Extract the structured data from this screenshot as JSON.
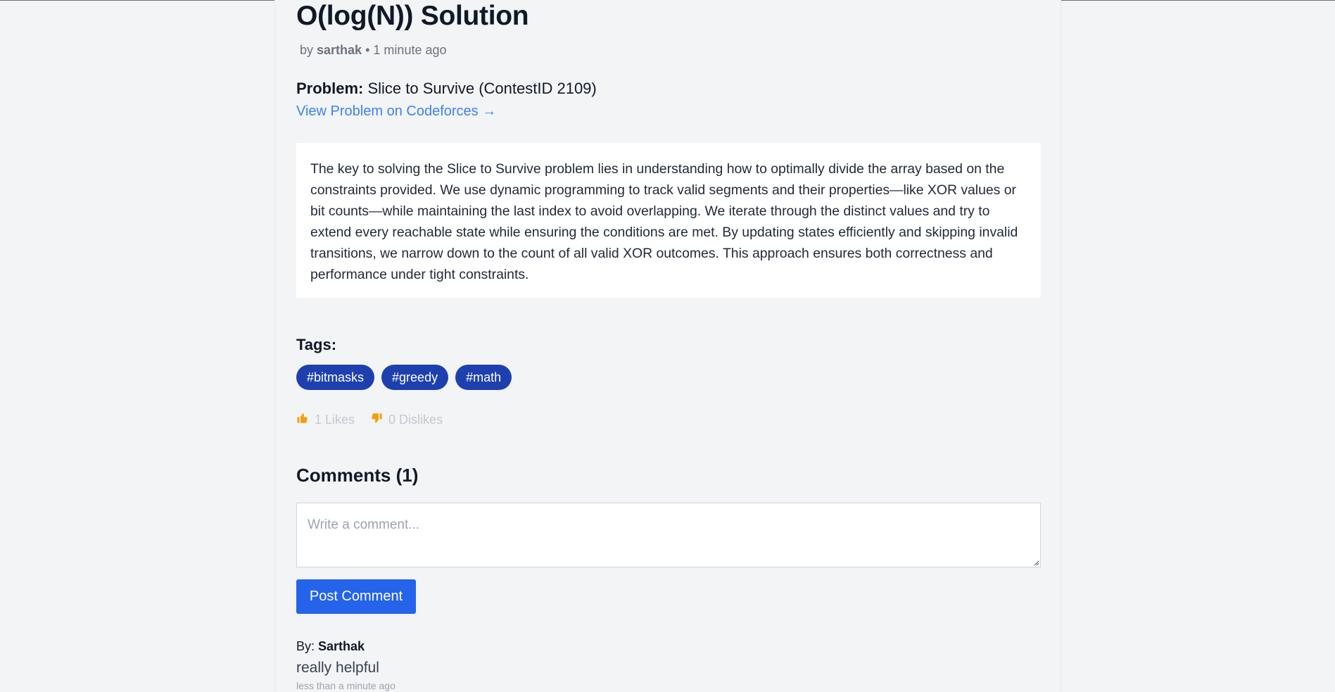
{
  "post": {
    "title": "O(log(N)) Solution",
    "by_prefix": "by",
    "author": "sarthak",
    "separator": "•",
    "time_ago": "1 minute ago",
    "problem_label": "Problem:",
    "problem_name": "Slice to Survive (ContestID 2109)",
    "problem_link": "View Problem on Codeforces →",
    "description": "The key to solving the Slice to Survive problem lies in understanding how to optimally divide the array based on the constraints provided. We use dynamic programming to track valid segments and their properties—like XOR values or bit counts—while maintaining the last index to avoid overlapping. We iterate through the distinct values and try to extend every reachable state while ensuring the conditions are met. By updating states efficiently and skipping invalid transitions, we narrow down to the count of all valid XOR outcomes. This approach ensures both correctness and performance under tight constraints."
  },
  "tags": {
    "heading": "Tags:",
    "items": [
      "#bitmasks",
      "#greedy",
      "#math"
    ]
  },
  "reactions": {
    "likes_icon": "thumbs-up-icon",
    "likes": "1 Likes",
    "dislikes_icon": "thumbs-down-icon",
    "dislikes": "0 Dislikes"
  },
  "comments": {
    "heading": "Comments (1)",
    "input_placeholder": "Write a comment...",
    "post_button": "Post Comment",
    "items": [
      {
        "by_prefix": "By:",
        "author": "Sarthak",
        "text": "really helpful",
        "time": "less than a minute ago"
      }
    ]
  },
  "colors": {
    "background": "#f3f4f6",
    "link": "#3b82f6",
    "tag": "#1e40af",
    "button": "#2563eb"
  }
}
